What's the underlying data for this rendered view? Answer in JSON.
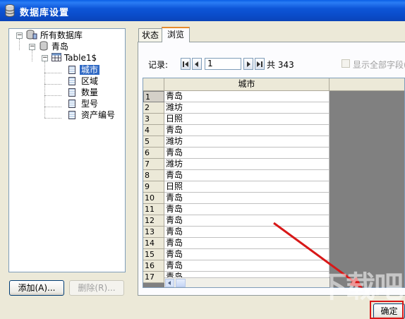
{
  "window": {
    "title": "数据库设置"
  },
  "tree": {
    "root_label": "所有数据库",
    "database_label": "青岛",
    "table_label": "Table1$",
    "fields": [
      "城市",
      "区域",
      "数量",
      "型号",
      "资产编号"
    ],
    "selected_field": "城市"
  },
  "buttons": {
    "add": "添加(A)...",
    "remove": "删除(R)...",
    "ok": "确定"
  },
  "tabs": [
    {
      "label": "状态"
    },
    {
      "label": "浏览"
    }
  ],
  "active_tab": "浏览",
  "record_nav": {
    "label": "记录:",
    "current": "1",
    "total_text": "共 343"
  },
  "show_all_fields": {
    "label": "显示全部字段(",
    "checked": false
  },
  "grid": {
    "column_header": "城市",
    "row_numbers": [
      "1",
      "2",
      "3",
      "4",
      "5",
      "6",
      "7",
      "8",
      "9",
      "10",
      "11",
      "12",
      "13",
      "14",
      "15",
      "16",
      "17"
    ],
    "rows": [
      "青岛",
      "潍坊",
      "日照",
      "青岛",
      "潍坊",
      "青岛",
      "潍坊",
      "青岛",
      "日照",
      "青岛",
      "青岛",
      "青岛",
      "青岛",
      "青岛",
      "青岛",
      "青岛",
      "青岛"
    ]
  },
  "watermark": "下载吧",
  "colors": {
    "title_bar": "#0a54d6",
    "selection": "#316ac5",
    "annotation": "#d81818"
  }
}
